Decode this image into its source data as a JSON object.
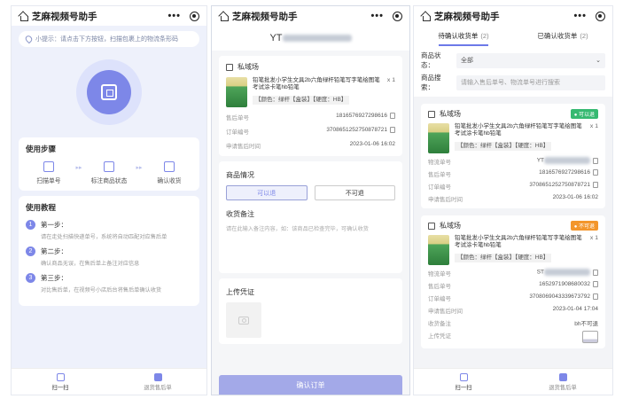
{
  "app_title": "芝麻视频号助手",
  "menu_dots": "•••",
  "scan_page": {
    "tip": "小提示：请点击下方按钮，扫描包裹上的物流条形码",
    "steps_title": "使用步骤",
    "steps": [
      "扫描单号",
      "标注商品状态",
      "确认收货"
    ],
    "tutorial_title": "使用教程",
    "tutorial": [
      {
        "num": "1",
        "title": "第一步：",
        "desc": "请在走处扫描快递单号，系统将自动匹配对应售后单"
      },
      {
        "num": "2",
        "title": "第二步：",
        "desc": "确认商品无误，在售后单上备注对应信息"
      },
      {
        "num": "3",
        "title": "第三步：",
        "desc": "对比售后单，在视频号小店后台将售后单确认收货"
      }
    ],
    "tabbar": [
      "扫一扫",
      "退货售后单"
    ]
  },
  "detail_page": {
    "order_id_prefix": "YT",
    "shop_name": "私域场",
    "product_name": "铅笔批发小学生文具2b六角绿杆铅笔写字笔绘图笔考试涂卡笔hb铅笔",
    "qty": "x 1",
    "spec": "【颜色：绿杆【盒装】【硬度：HB】",
    "fields": [
      {
        "label": "售后单号",
        "value": "1816576927298616"
      },
      {
        "label": "订单编号",
        "value": "3708651252750878721"
      },
      {
        "label": "申请售后时间",
        "value": "2023-01-06 16:02"
      }
    ],
    "condition_title": "商品情况",
    "choice_returnable": "可以退",
    "choice_not_returnable": "不可退",
    "remark_title": "收货备注",
    "remark_placeholder": "请在此输入备注内容，如：该商品已检查完毕，可确认收货",
    "proof_title": "上传凭证",
    "confirm_button": "确认订单"
  },
  "list_page": {
    "tab_pending": "待确认收货单",
    "tab_pending_count": "(2)",
    "tab_done": "已确认收货单",
    "tab_done_count": "(2)",
    "status_label": "商品状态：",
    "status_value": "全部",
    "search_label": "商品搜索：",
    "search_placeholder": "请输入售后单号、物流单号进行搜索",
    "orders": [
      {
        "shop": "私域场",
        "badge": "● 可以退",
        "product": "铅笔批发小学生文具2b六角绿杆铅笔写字笔绘图笔考试涂卡笔hb铅笔",
        "qty": "x 1",
        "spec": "【颜色：绿杆【盒装】【硬度：HB】",
        "logistics_label": "物流单号",
        "logistics_prefix": "YT",
        "after_label": "售后单号",
        "after_value": "1816576927298616",
        "order_label": "订单编号",
        "order_value": "3708651252750878721",
        "time_label": "申请售后时间",
        "time_value": "2023-01-06 16:02"
      },
      {
        "shop": "私域场",
        "badge": "● 不可退",
        "product": "铅笔批发小学生文具2b六角绿杆铅笔写字笔绘图笔考试涂卡笔hb铅笔",
        "qty": "x 1",
        "spec": "【颜色：绿杆【盒装】【硬度：HB】",
        "logistics_label": "物流单号",
        "logistics_prefix": "ST",
        "after_label": "售后单号",
        "after_value": "1652971908680032",
        "order_label": "订单编号",
        "order_value": "3708069043339673792",
        "time_label": "申请售后时间",
        "time_value": "2023-01-04 17:04",
        "remark_label": "收货备注",
        "remark_value": "bh不可退",
        "proof_label": "上传凭证"
      }
    ],
    "tabbar": [
      "扫一扫",
      "退货售后单"
    ]
  },
  "colors": {
    "accent": "#7d87e8",
    "green": "#36b971",
    "orange": "#f3962c"
  }
}
